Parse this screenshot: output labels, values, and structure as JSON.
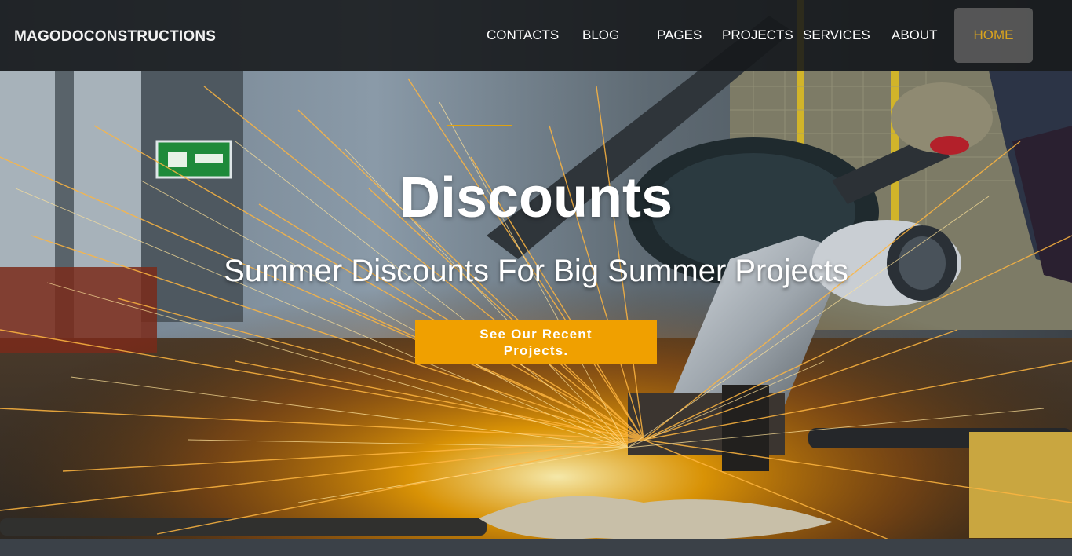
{
  "header": {
    "brand": "MAGODOCONSTRUCTIONS",
    "nav": [
      {
        "label": "CONTACTS"
      },
      {
        "label": "BLOG"
      },
      {
        "label": "PAGES"
      },
      {
        "label": "PROJECTS"
      },
      {
        "label": "SERVICES"
      },
      {
        "label": "ABOUT"
      },
      {
        "label": "HOME",
        "active": true
      }
    ]
  },
  "hero": {
    "title": "Discounts",
    "subtitle": "Summer Discounts For Big Summer Projects",
    "cta_label": "See Our Recent Projects."
  },
  "colors": {
    "accent": "#f0a000",
    "active_nav_text": "#d9a31e",
    "nav_background": "#16181a"
  },
  "background_image": "metal-cutting-grinder-sparks-photo"
}
